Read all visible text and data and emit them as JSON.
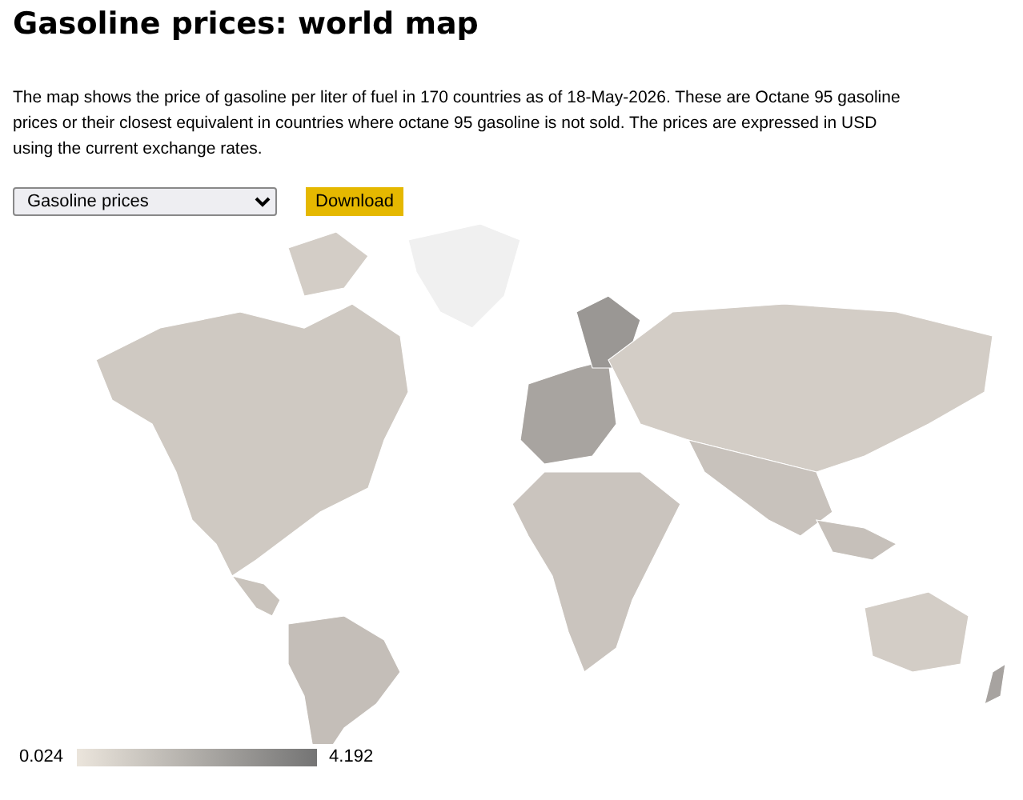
{
  "title": "Gasoline prices: world map",
  "description": "The map shows the price of gasoline per liter of fuel in 170 countries as of 18-May-2026. These are Octane 95 gasoline prices or their closest equivalent in countries where octane 95 gasoline is not sold. The prices are expressed in USD using the current exchange rates.",
  "dataset_select": {
    "value": "Gasoline prices"
  },
  "download_button": {
    "label": "Download"
  },
  "legend": {
    "min_label": "0.024",
    "max_label": "4.192"
  }
}
